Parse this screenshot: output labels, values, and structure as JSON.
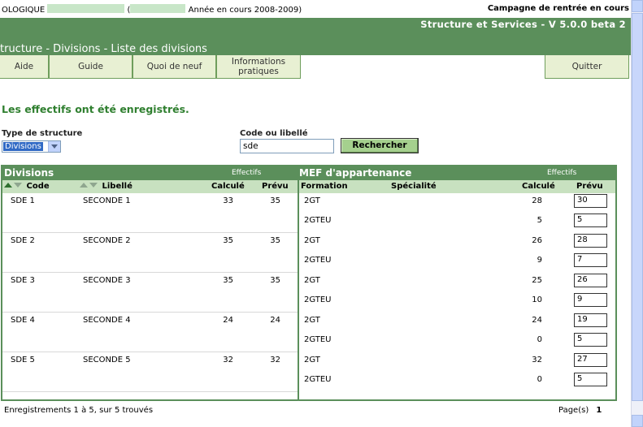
{
  "top": {
    "left_text_a": "OLOGIQUE",
    "left_text_b": "(",
    "left_text_c": "Année en cours 2008-2009)",
    "right_text": "Campagne de rentrée en cours"
  },
  "banner": {
    "version": "Structure et Services - V 5.0.0 beta 2",
    "breadcrumb": "tructure - Divisions - Liste des divisions"
  },
  "menu": {
    "aide": "Aide",
    "guide": "Guide",
    "quoi": "Quoi de neuf",
    "info1": "Informations",
    "info2": "pratiques",
    "quitter": "Quitter"
  },
  "message": "Les effectifs ont été enregistrés.",
  "filters": {
    "type_label": "Type de structure",
    "type_value": "Divisions",
    "code_label": "Code ou libellé",
    "code_value": "sde",
    "search_button": "Rechercher"
  },
  "grid": {
    "divisions_title": "Divisions",
    "effectifs_left": "Effectifs",
    "mef_title": "MEF d'appartenance",
    "effectifs_right": "Effectifs",
    "col_code": "Code",
    "col_libelle": "Libellé",
    "col_calcule": "Calculé",
    "col_prevu": "Prévu",
    "col_formation": "Formation",
    "col_specialite": "Spécialité",
    "col_calcule2": "Calculé",
    "col_prevu2": "Prévu",
    "rows": [
      {
        "code": "SDE 1",
        "libelle": "SECONDE 1",
        "calcule": "33",
        "prevu": "35",
        "mef": [
          {
            "formation": "2GT",
            "calcule": "28",
            "prevu": "30"
          },
          {
            "formation": "2GTEU",
            "calcule": "5",
            "prevu": "5"
          }
        ]
      },
      {
        "code": "SDE 2",
        "libelle": "SECONDE 2",
        "calcule": "35",
        "prevu": "35",
        "mef": [
          {
            "formation": "2GT",
            "calcule": "26",
            "prevu": "28"
          },
          {
            "formation": "2GTEU",
            "calcule": "9",
            "prevu": "7"
          }
        ]
      },
      {
        "code": "SDE 3",
        "libelle": "SECONDE 3",
        "calcule": "35",
        "prevu": "35",
        "mef": [
          {
            "formation": "2GT",
            "calcule": "25",
            "prevu": "26"
          },
          {
            "formation": "2GTEU",
            "calcule": "10",
            "prevu": "9"
          }
        ]
      },
      {
        "code": "SDE 4",
        "libelle": "SECONDE 4",
        "calcule": "24",
        "prevu": "24",
        "mef": [
          {
            "formation": "2GT",
            "calcule": "24",
            "prevu": "19"
          },
          {
            "formation": "2GTEU",
            "calcule": "0",
            "prevu": "5"
          }
        ]
      },
      {
        "code": "SDE 5",
        "libelle": "SECONDE 5",
        "calcule": "32",
        "prevu": "32",
        "mef": [
          {
            "formation": "2GT",
            "calcule": "32",
            "prevu": "27"
          },
          {
            "formation": "2GTEU",
            "calcule": "0",
            "prevu": "5"
          }
        ]
      }
    ]
  },
  "footer": {
    "records": "Enregistrements 1 à 5, sur 5 trouvés",
    "pages_label": "Page(s)",
    "page": "1"
  }
}
